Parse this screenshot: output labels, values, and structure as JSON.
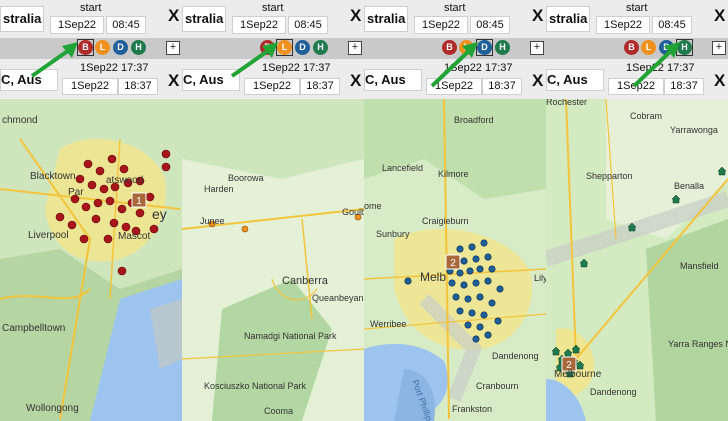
{
  "panels": [
    {
      "location_top": "stralia",
      "start_label": "start",
      "start_date": "1Sep22",
      "start_time": "08:45",
      "close": "X",
      "buttons": [
        "B",
        "L",
        "D",
        "H"
      ],
      "selected": "B",
      "add": "+",
      "location_bottom": "C, Aus",
      "end_datetime": "1Sep22 17:37",
      "end_date": "1Sep22",
      "end_time": "18:37",
      "map_labels": {
        "a": "chmond",
        "b": "Blacktown",
        "c": "Par",
        "d": "atswood",
        "e": "Liverpool",
        "f": "Mascot",
        "g": "ey",
        "h": "Campbelltown",
        "i": "Wollongong"
      },
      "cluster": "1"
    },
    {
      "location_top": "stralia",
      "start_label": "start",
      "start_date": "1Sep22",
      "start_time": "08:45",
      "close": "X",
      "buttons": [
        "B",
        "L",
        "D",
        "H"
      ],
      "selected": "L",
      "add": "+",
      "location_bottom": "C, Aus",
      "end_datetime": "1Sep22 17:37",
      "end_date": "1Sep22",
      "end_time": "18:37",
      "map_labels": {
        "a": "Boorowa",
        "b": "Harden",
        "c": "Junee",
        "d": "Goulb",
        "e": "Canberra",
        "f": "Queanbeyan",
        "g": "Namadgi\nNational Park",
        "h": "Kosciuszko\nNational Park",
        "i": "Cooma"
      }
    },
    {
      "location_top": "stralia",
      "start_label": "start",
      "start_date": "1Sep22",
      "start_time": "08:45",
      "close": "X",
      "buttons": [
        "B",
        "L",
        "D",
        "H"
      ],
      "selected": "D",
      "add": "+",
      "location_bottom": "C, Aus",
      "end_datetime": "1Sep22 17:37",
      "end_date": "1Sep22",
      "end_time": "18:37",
      "map_labels": {
        "a": "Broadford",
        "b": "Lancefield",
        "c": "Kilmore",
        "d": "ome",
        "e": "Sunbury",
        "f": "Craigieburn",
        "g": "Melb",
        "h": "Werribee",
        "i": "Dandenong",
        "j": "Cranbourn",
        "k": "Frankston",
        "l": "Port Phillip",
        "m": "Lily"
      },
      "cluster": "2"
    },
    {
      "location_top": "stralia",
      "start_label": "start",
      "start_date": "1Sep22",
      "start_time": "08:45",
      "close": "X",
      "buttons": [
        "B",
        "L",
        "D",
        "H"
      ],
      "selected": "H",
      "add": "+",
      "location_bottom": "C, Aus",
      "end_datetime": "1Sep22 17:37",
      "end_date": "1Sep22",
      "end_time": "18:37",
      "map_labels": {
        "a": "Rochester",
        "b": "Cobram",
        "c": "Yarrawonga",
        "d": "Shepparton",
        "e": "Benalla",
        "f": "Mansfield",
        "g": "Yarra Ranges\nNational Park",
        "h": "Melbourne",
        "i": "Dandenong"
      },
      "cluster": "2"
    }
  ],
  "colors": {
    "business": "#b02a2a",
    "leisure": "#f0901e",
    "dining": "#1f5f9a",
    "home": "#1f7a4e",
    "arrow": "#21a336"
  }
}
